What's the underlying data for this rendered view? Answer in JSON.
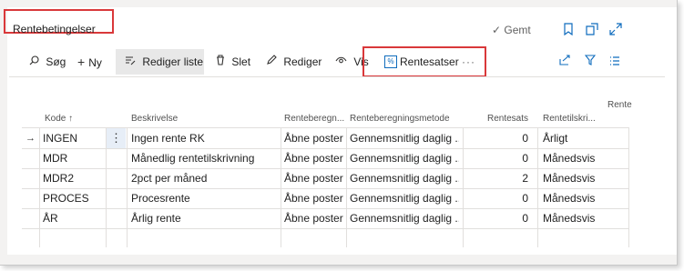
{
  "page": {
    "title": "Rentebetingelser",
    "saved_label": "Gemt"
  },
  "header_icons": [
    "bookmark-icon",
    "open-new-window-icon",
    "expand-icon"
  ],
  "actions": {
    "search": "Søg",
    "new": "Ny",
    "edit_list": "Rediger liste",
    "delete": "Slet",
    "edit": "Rediger",
    "view": "Vis",
    "rates": "Rentesatser",
    "more": "···"
  },
  "toolbar_icons": [
    "share-icon",
    "filter-icon",
    "list-view-icon"
  ],
  "columns": {
    "code": "Kode",
    "code_sort": "↑",
    "description": "Beskrivelse",
    "calc_basis": "Renteberegn...",
    "calc_method": "Renteberegningsmetode",
    "rate": "Rentesats",
    "addition": "Rentetilskri...",
    "cutoff": "Rente"
  },
  "rows": [
    {
      "code": "INGEN",
      "description": "Ingen rente RK",
      "calc_basis": "Åbne poster",
      "calc_method": "Gennemsnitlig daglig ...",
      "rate": "0",
      "addition": "Årligt"
    },
    {
      "code": "MDR",
      "description": "Månedlig rentetilskrivning",
      "calc_basis": "Åbne poster",
      "calc_method": "Gennemsnitlig daglig ...",
      "rate": "0",
      "addition": "Månedsvis"
    },
    {
      "code": "MDR2",
      "description": "2pct per måned",
      "calc_basis": "Åbne poster",
      "calc_method": "Gennemsnitlig daglig ...",
      "rate": "2",
      "addition": "Månedsvis"
    },
    {
      "code": "PROCES",
      "description": "Procesrente",
      "calc_basis": "Åbne poster",
      "calc_method": "Gennemsnitlig daglig ...",
      "rate": "0",
      "addition": "Månedsvis"
    },
    {
      "code": "ÅR",
      "description": "Årlig rente",
      "calc_basis": "Åbne poster",
      "calc_method": "Gennemsnitlig daglig ...",
      "rate": "0",
      "addition": "Månedsvis"
    }
  ],
  "selected_row": {
    "indicator": "→",
    "menu": "⋮"
  },
  "colors": {
    "accent": "#0f6cbd",
    "highlight": "#d9383a"
  }
}
